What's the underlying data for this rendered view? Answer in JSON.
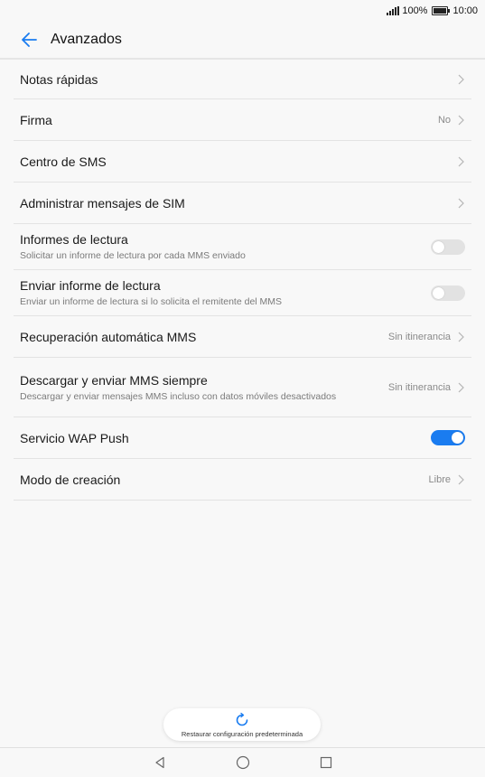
{
  "status": {
    "battery_percent": "100%",
    "time": "10:00"
  },
  "header": {
    "title": "Avanzados"
  },
  "settings": {
    "quick_notes": {
      "title": "Notas rápidas"
    },
    "signature": {
      "title": "Firma",
      "value": "No"
    },
    "sms_center": {
      "title": "Centro de SMS"
    },
    "sim_messages": {
      "title": "Administrar mensajes de SIM"
    },
    "read_reports": {
      "title": "Informes de lectura",
      "subtitle": "Solicitar un informe de lectura por cada MMS enviado",
      "enabled": false
    },
    "send_read_report": {
      "title": "Enviar informe de lectura",
      "subtitle": "Enviar un informe de lectura si lo solicita el remitente del MMS",
      "enabled": false
    },
    "mms_auto_retrieve": {
      "title": "Recuperación automática MMS",
      "value": "Sin itinerancia"
    },
    "mms_always": {
      "title": "Descargar y enviar MMS siempre",
      "subtitle": "Descargar y enviar mensajes MMS incluso con datos móviles desactivados",
      "value": "Sin itinerancia"
    },
    "wap_push": {
      "title": "Servicio WAP Push",
      "enabled": true
    },
    "creation_mode": {
      "title": "Modo de creación",
      "value": "Libre"
    }
  },
  "footer": {
    "restore_label": "Restaurar configuración predeterminada"
  },
  "colors": {
    "accent": "#1a7cf0",
    "toggle_off": "#e2e2e2"
  }
}
